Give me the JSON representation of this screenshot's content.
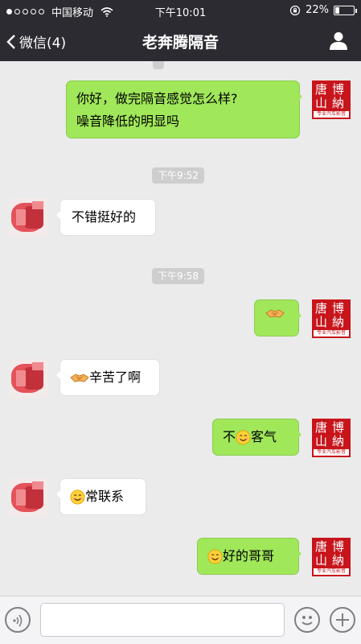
{
  "status_bar": {
    "signal_icon": "signal-dots-icon",
    "carrier": "中国移动",
    "wifi_icon": "wifi-icon",
    "time": "下午10:01",
    "rotation_lock_icon": "rotation-lock-icon",
    "battery_percent": "22%",
    "battery_level": 0.22
  },
  "nav": {
    "back_label": "微信(4)",
    "back_icon": "chevron-left-icon",
    "title": "老奔腾隔音",
    "profile_icon": "person-icon"
  },
  "chat": {
    "partial_time_top": "",
    "time_badges": [
      "下午9:52",
      "下午9:58"
    ],
    "shop_avatar": {
      "chars": [
        "唐",
        "博",
        "山",
        "納"
      ],
      "strip_text": "专业汽车影音",
      "color": "#c8141b"
    },
    "messages": [
      {
        "from": "me",
        "lines": [
          "你好，做完隔音感觉怎么样?",
          "噪音降低的明显吗"
        ]
      },
      {
        "from": "them",
        "text": "不错挺好的"
      },
      {
        "from": "me",
        "emoji": "handshake-emoji"
      },
      {
        "from": "them",
        "emoji": "handshake-emoji",
        "text": "辛苦了啊"
      },
      {
        "from": "me",
        "pre": "不",
        "emoji": "smile-emoji",
        "text": "客气"
      },
      {
        "from": "them",
        "emoji": "smile-emoji",
        "text": "常联系"
      },
      {
        "from": "me",
        "emoji": "smile-emoji",
        "text": "好的哥哥"
      }
    ]
  },
  "input_bar": {
    "voice_icon": "voice-icon",
    "text_value": "",
    "emoji_icon": "emoji-icon",
    "plus_icon": "plus-icon"
  },
  "colors": {
    "bar_bg": "#2b2b31",
    "chat_bg": "#ebebeb",
    "out_bubble": "#a0e75a",
    "in_bubble": "#ffffff",
    "time_badge": "#cecece"
  }
}
